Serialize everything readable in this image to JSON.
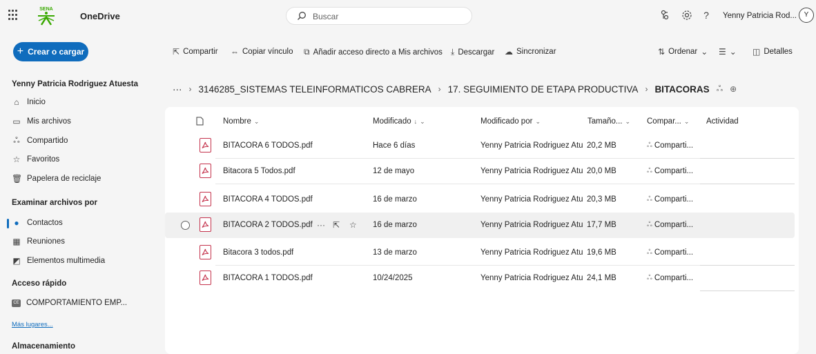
{
  "header": {
    "app_title": "OneDrive",
    "logo_text": "SENA",
    "search_placeholder": "Buscar",
    "user_name": "Yenny Patricia Rod...",
    "avatar_initial": "Y"
  },
  "create_button": {
    "label": "Crear o cargar"
  },
  "toolbar": {
    "share": "Compartir",
    "copy_link": "Copiar vínculo",
    "add_shortcut": "Añadir acceso directo a Mis archivos",
    "download": "Descargar",
    "sync": "Sincronizar",
    "sort": "Ordenar",
    "details": "Detalles"
  },
  "sidebar": {
    "owner": "Yenny Patricia Rodriguez Atuesta",
    "nav": [
      {
        "label": "Inicio"
      },
      {
        "label": "Mis archivos"
      },
      {
        "label": "Compartido"
      },
      {
        "label": "Favoritos"
      },
      {
        "label": "Papelera de reciclaje"
      }
    ],
    "browse_heading": "Examinar archivos por",
    "browse": [
      {
        "label": "Contactos"
      },
      {
        "label": "Reuniones"
      },
      {
        "label": "Elementos multimedia"
      }
    ],
    "quick_access_heading": "Acceso rápido",
    "quick_access": [
      {
        "label": "COMPORTAMIENTO EMP..."
      }
    ],
    "more_places": "Más lugares...",
    "storage_heading": "Almacenamiento"
  },
  "breadcrumb": {
    "ellipsis": "···",
    "items": [
      "3146285_SISTEMAS TELEINFORMATICOS CABRERA",
      "17. SEGUIMIENTO DE ETAPA PRODUCTIVA",
      "BITACORAS"
    ]
  },
  "table": {
    "columns": {
      "name": "Nombre",
      "modified": "Modificado",
      "modified_by": "Modificado por",
      "size": "Tamaño...",
      "sharing": "Compar...",
      "activity": "Actividad"
    },
    "rows": [
      {
        "name": "BITACORA 6 TODOS.pdf",
        "modified": "Hace 6 días",
        "modified_by": "Yenny Patricia Rodriguez Atuesta",
        "size": "20,2 MB",
        "sharing": "Comparti..."
      },
      {
        "name": "Bitacora 5 Todos.pdf",
        "modified": "12 de mayo",
        "modified_by": "Yenny Patricia Rodriguez Atuesta",
        "size": "20,0 MB",
        "sharing": "Comparti..."
      },
      {
        "name": "BITACORA 4 TODOS.pdf",
        "modified": "16 de marzo",
        "modified_by": "Yenny Patricia Rodriguez Atuesta",
        "size": "20,3 MB",
        "sharing": "Comparti..."
      },
      {
        "name": "BITACORA 2 TODOS.pdf",
        "modified": "16 de marzo",
        "modified_by": "Yenny Patricia Rodriguez Atuesta",
        "size": "17,7 MB",
        "sharing": "Comparti..."
      },
      {
        "name": "Bitacora 3 todos.pdf",
        "modified": "13 de marzo",
        "modified_by": "Yenny Patricia Rodriguez Atuesta",
        "size": "19,6 MB",
        "sharing": "Comparti..."
      },
      {
        "name": "BITACORA 1 TODOS.pdf",
        "modified": "10/24/2025",
        "modified_by": "Yenny Patricia Rodriguez Atuesta",
        "size": "24,1 MB",
        "sharing": "Comparti..."
      }
    ]
  },
  "colors": {
    "accent": "#0f6cbd",
    "pdf_red": "#c4314b"
  }
}
